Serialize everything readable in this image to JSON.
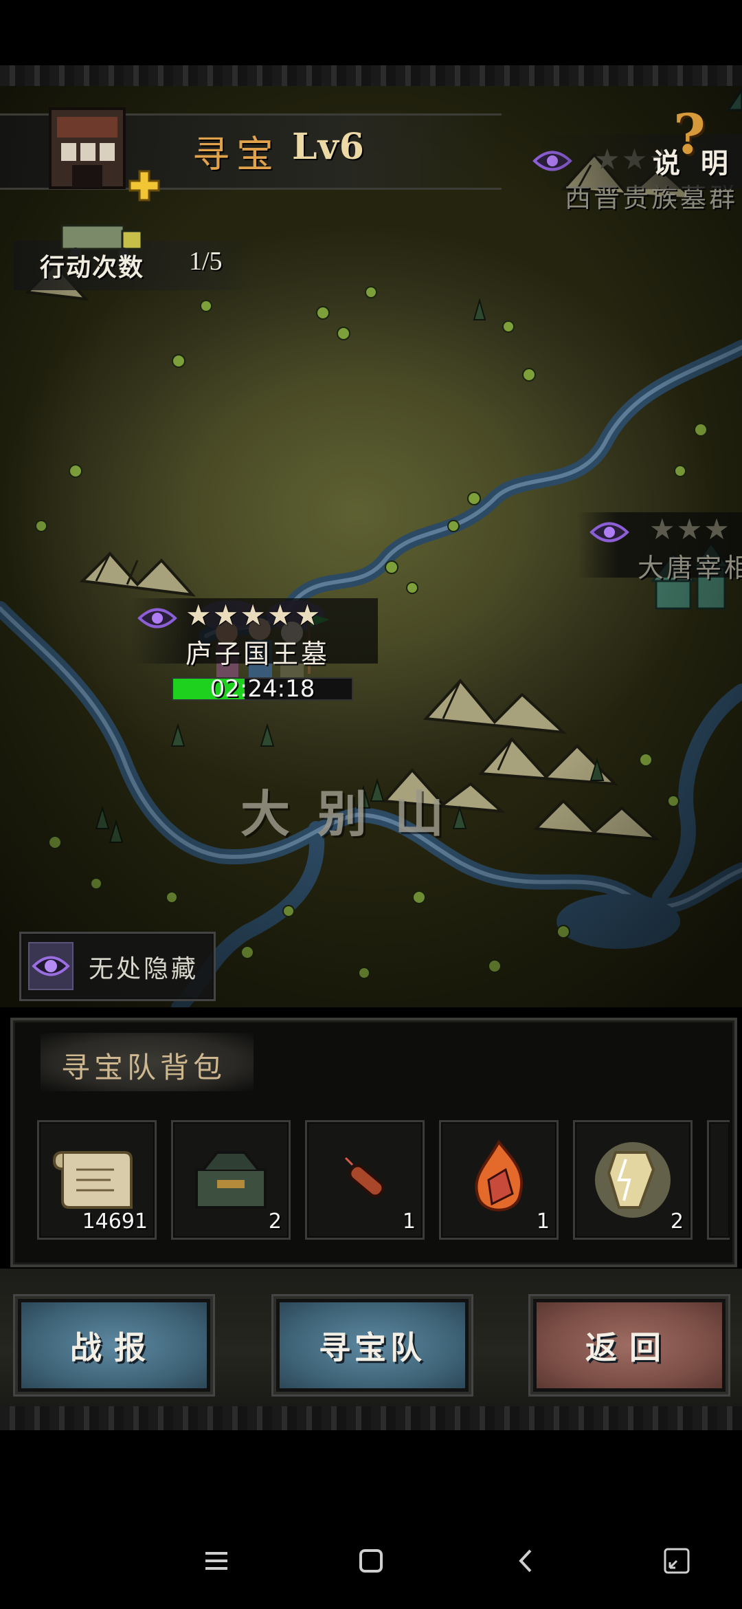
{
  "header": {
    "title": "寻宝",
    "level": "Lv6"
  },
  "actions": {
    "label": "行动次数",
    "value": "1/5"
  },
  "help": {
    "label": "说 明",
    "icon": "question-icon"
  },
  "locations": [
    {
      "name": "西晋贵族墓群",
      "stars": 3,
      "max_stars": 3,
      "lit": false
    },
    {
      "name": "大唐宰相",
      "stars": 3,
      "max_stars": 3,
      "lit": false
    },
    {
      "name": "庐子国王墓",
      "stars": 5,
      "max_stars": 5,
      "lit": true
    }
  ],
  "expedition": {
    "timer": "02:24:18",
    "progress": 0.4
  },
  "map": {
    "region_label": "大别山"
  },
  "skill": {
    "label": "无处隐藏",
    "icon": "eye-icon"
  },
  "bag": {
    "title": "寻宝队背包",
    "items": [
      {
        "icon": "scroll-map-icon",
        "count": "14691"
      },
      {
        "icon": "toolbox-icon",
        "count": "2"
      },
      {
        "icon": "firecracker-icon",
        "count": "1"
      },
      {
        "icon": "fire-stone-icon",
        "count": "1"
      },
      {
        "icon": "lightning-crystal-icon",
        "count": "2"
      }
    ]
  },
  "buttons": {
    "report": "战报",
    "team": "寻宝队",
    "back": "返回"
  },
  "colors": {
    "title": "#e0a24a",
    "timer_fill": "#1fd11f",
    "button_blue": "#4a7088",
    "button_red": "#7b4e46"
  }
}
